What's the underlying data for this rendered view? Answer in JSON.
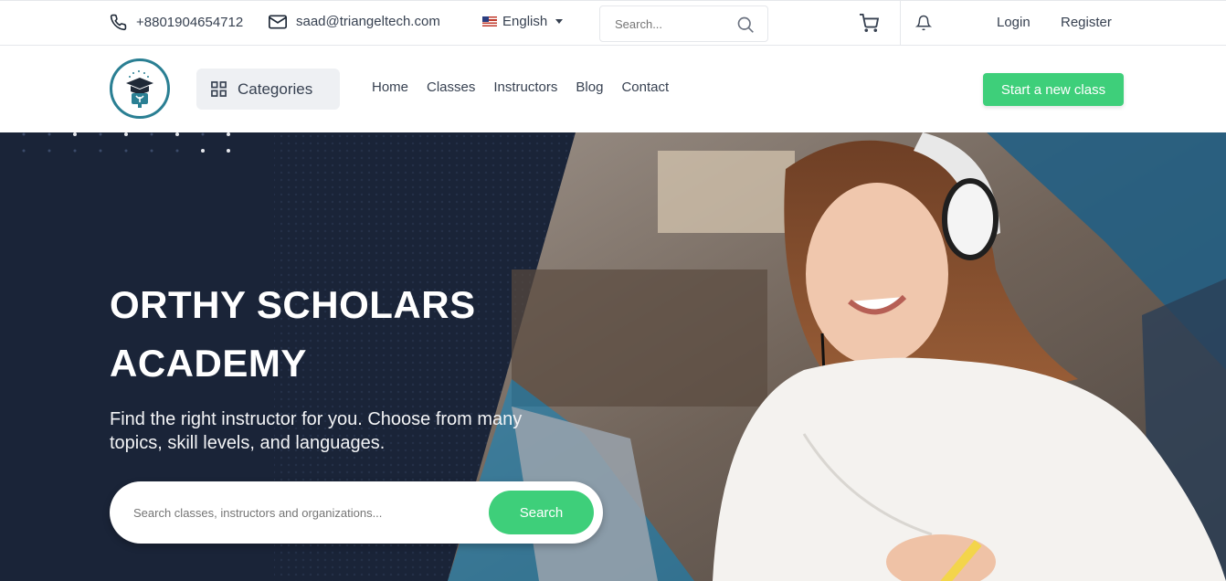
{
  "topbar": {
    "phone": "+8801904654712",
    "email": "saad@triangeltech.com",
    "language": "English",
    "search_placeholder": "Search...",
    "login": "Login",
    "register": "Register"
  },
  "nav": {
    "categories_label": "Categories",
    "links": [
      "Home",
      "Classes",
      "Instructors",
      "Blog",
      "Contact"
    ],
    "cta_label": "Start a new class"
  },
  "hero": {
    "title": "ORTHY SCHOLARS ACADEMY",
    "subtitle": "Find the right instructor for you. Choose from many topics, skill levels, and languages.",
    "search_placeholder": "Search classes, instructors and organizations...",
    "search_button": "Search"
  },
  "colors": {
    "accent": "#3ecf7a",
    "hero_dark": "#1a2438",
    "logo_ring": "#2a7f93"
  }
}
